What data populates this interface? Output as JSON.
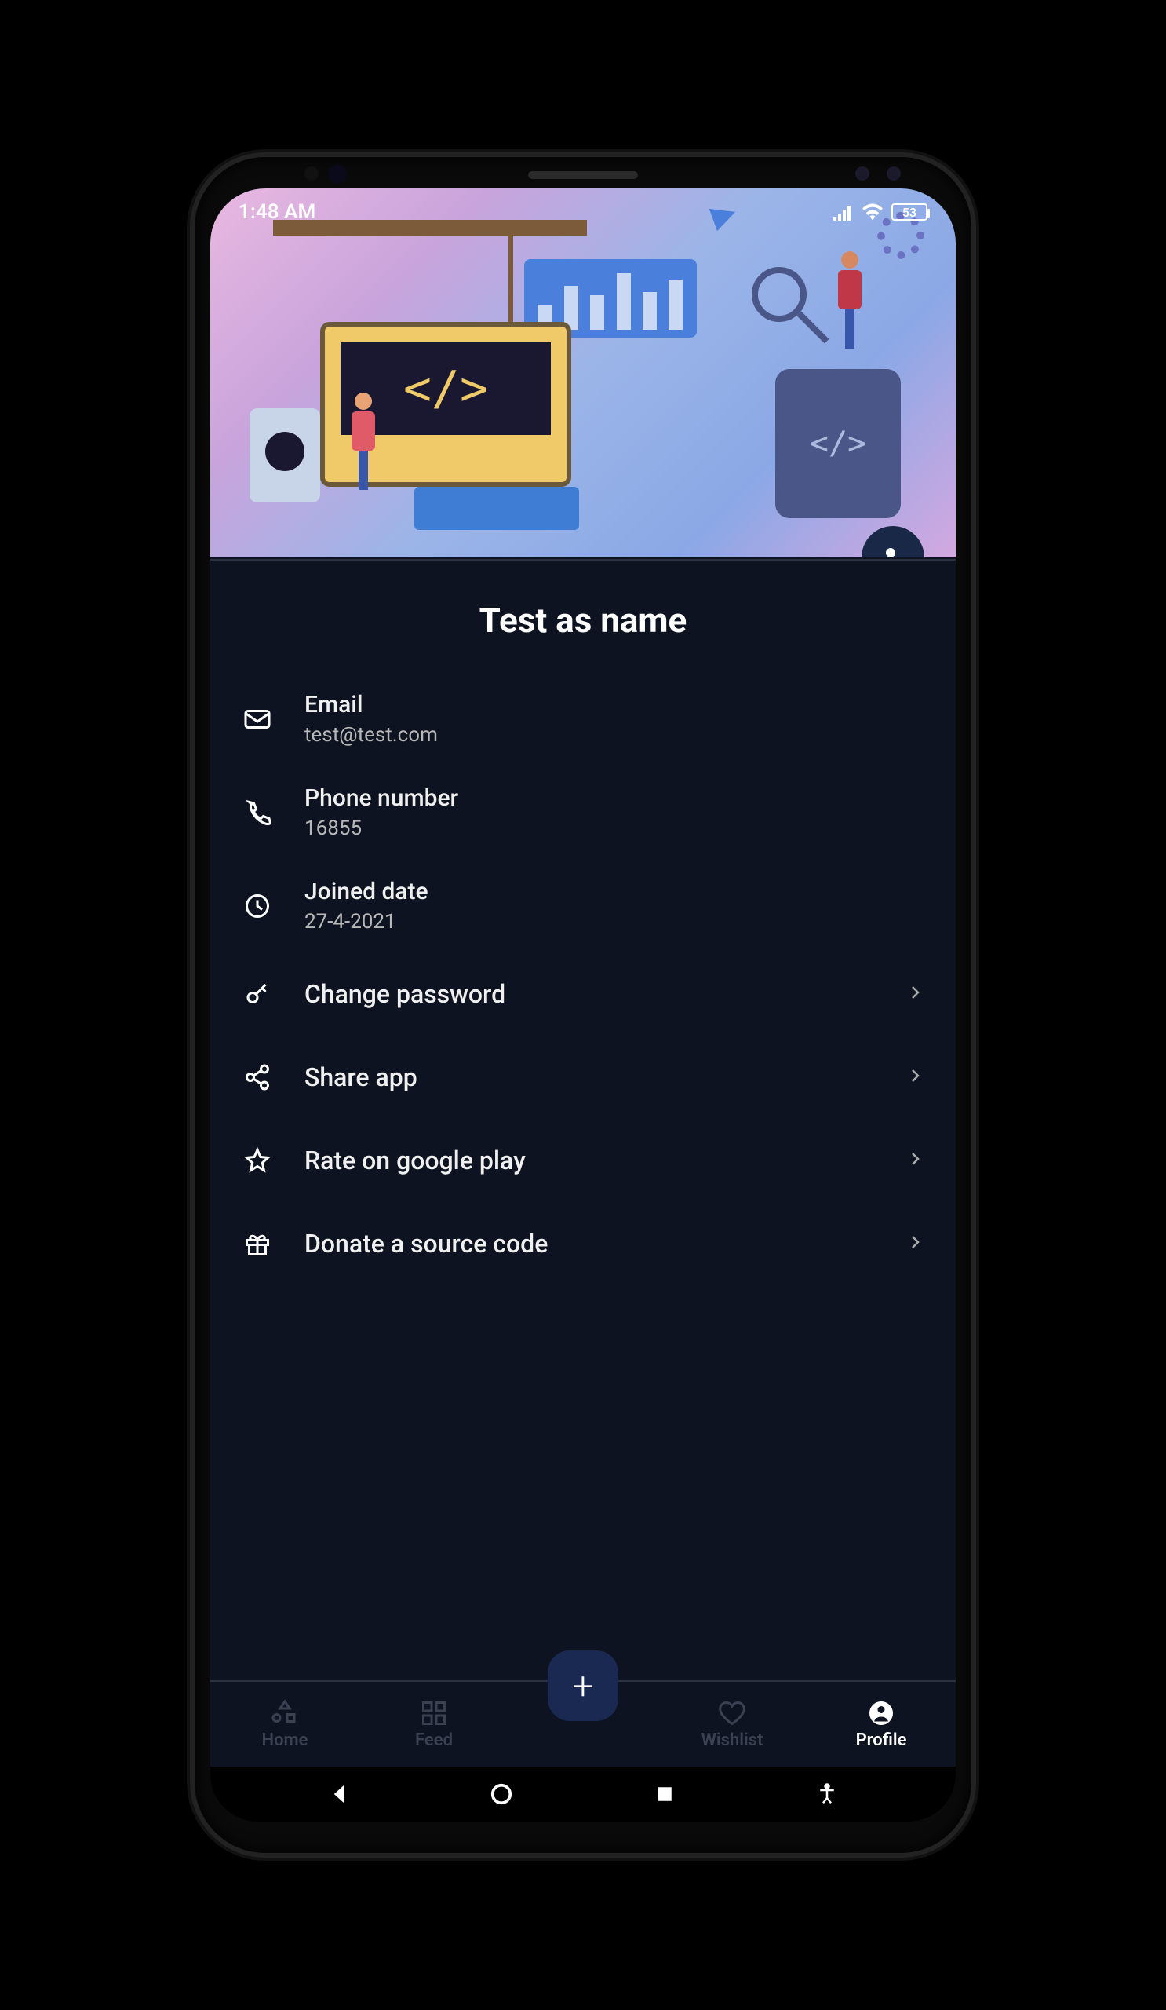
{
  "status": {
    "time": "1:48 AM",
    "battery": "53"
  },
  "profile": {
    "name": "Test as name"
  },
  "info": {
    "email": {
      "label": "Email",
      "value": "test@test.com"
    },
    "phone": {
      "label": "Phone number",
      "value": "16855"
    },
    "joined": {
      "label": "Joined date",
      "value": "27-4-2021"
    }
  },
  "actions": {
    "password": "Change password",
    "share": "Share app",
    "rate": "Rate on google play",
    "donate": "Donate a source code"
  },
  "nav": {
    "home": "Home",
    "feed": "Feed",
    "wishlist": "Wishlist",
    "profile": "Profile"
  }
}
